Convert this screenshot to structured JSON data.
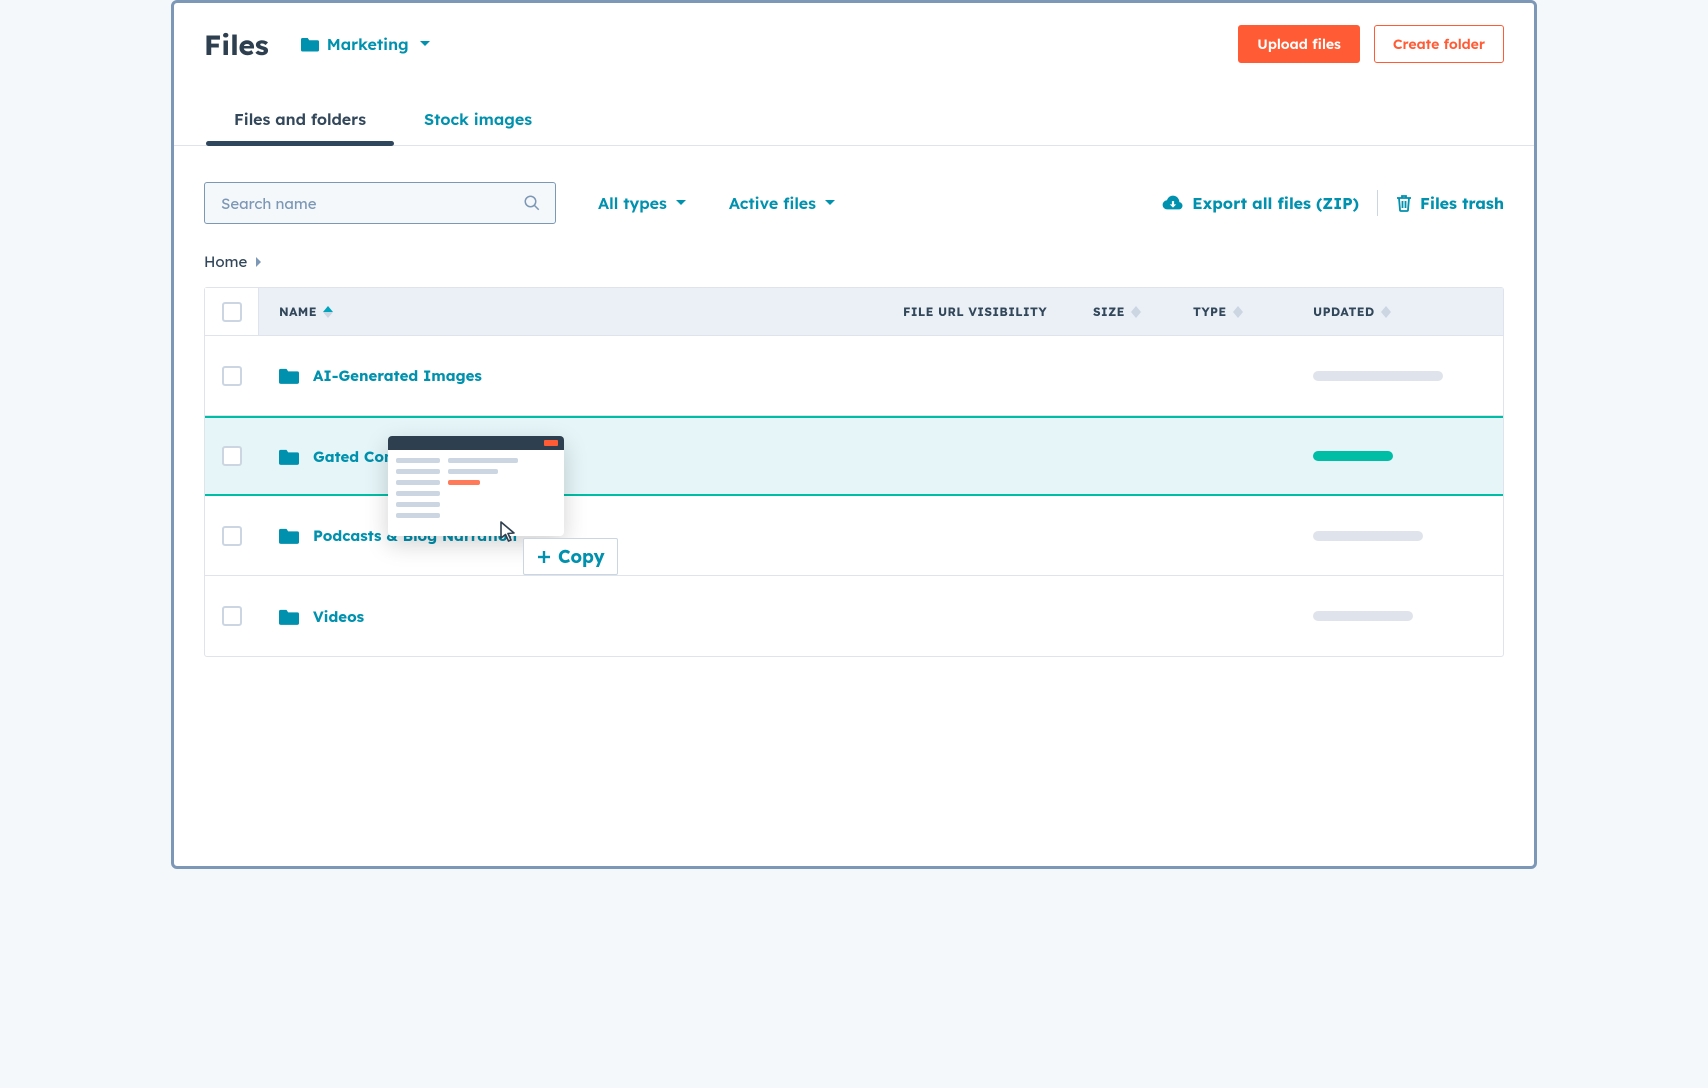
{
  "header": {
    "title": "Files",
    "folder_label": "Marketing",
    "upload_label": "Upload files",
    "create_folder_label": "Create folder"
  },
  "tabs": [
    {
      "label": "Files and folders",
      "active": true
    },
    {
      "label": "Stock images",
      "active": false
    }
  ],
  "toolbar": {
    "search_placeholder": "Search name",
    "filter_types": "All types",
    "filter_status": "Active files",
    "export_label": "Export all files (ZIP)",
    "trash_label": "Files trash"
  },
  "breadcrumbs": {
    "home": "Home"
  },
  "columns": {
    "name": "NAME",
    "visibility": "FILE URL VISIBILITY",
    "size": "SIZE",
    "type": "TYPE",
    "updated": "UPDATED"
  },
  "rows": [
    {
      "name": "AI-Generated Images",
      "highlighted": false
    },
    {
      "name": "Gated Cont",
      "highlighted": true
    },
    {
      "name": "Podcasts & Blog Narration",
      "highlighted": false
    },
    {
      "name": "Videos",
      "highlighted": false
    }
  ],
  "drag": {
    "copy_label": "Copy"
  }
}
